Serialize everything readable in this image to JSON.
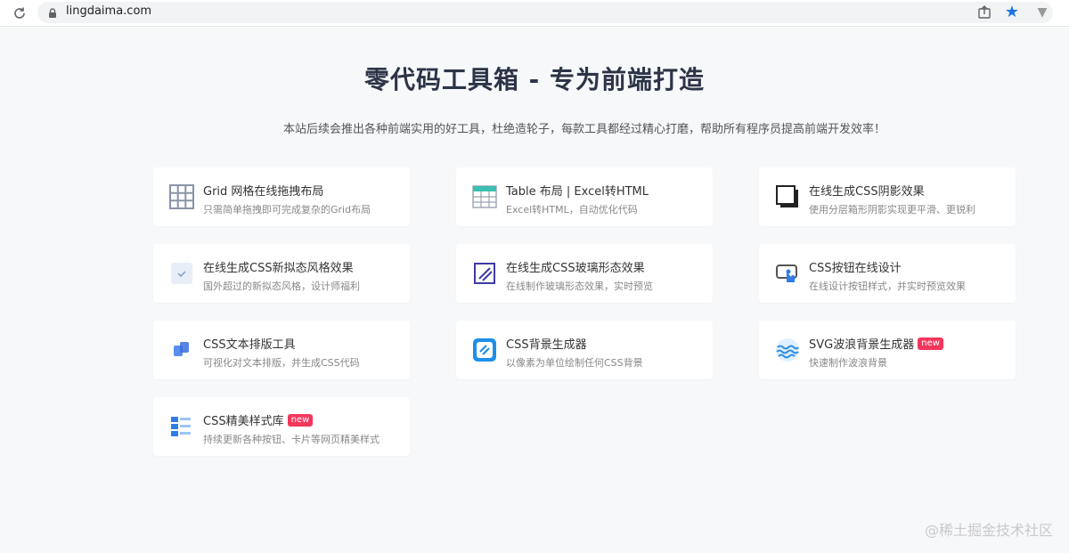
{
  "browser": {
    "url": "lingdaima.com"
  },
  "page": {
    "title": "零代码工具箱 - 专为前端打造",
    "subtitle": "本站后续会推出各种前端实用的好工具，杜绝造轮子，每款工具都经过精心打磨，帮助所有程序员提高前端开发效率！"
  },
  "tools": [
    {
      "title": "Grid 网格在线拖拽布局",
      "desc": "只需简单拖拽即可完成复杂的Grid布局",
      "badge": "",
      "icon": "grid-icon"
    },
    {
      "title": "Table 布局 | Excel转HTML",
      "desc": "Excel转HTML，自动优化代码",
      "badge": "",
      "icon": "table-icon"
    },
    {
      "title": "在线生成CSS阴影效果",
      "desc": "使用分层箱形阴影实现更平滑、更锐利",
      "badge": "",
      "icon": "shadow-icon"
    },
    {
      "title": "在线生成CSS新拟态风格效果",
      "desc": "国外超过的新拟态风格，设计师福利",
      "badge": "",
      "icon": "neumorphism-icon"
    },
    {
      "title": "在线生成CSS玻璃形态效果",
      "desc": "在线制作玻璃形态效果，实时预览",
      "badge": "",
      "icon": "glass-icon"
    },
    {
      "title": "CSS按钮在线设计",
      "desc": "在线设计按钮样式，并实时预览效果",
      "badge": "",
      "icon": "button-icon"
    },
    {
      "title": "CSS文本排版工具",
      "desc": "可视化对文本排版，并生成CSS代码",
      "badge": "",
      "icon": "text-layout-icon"
    },
    {
      "title": "CSS背景生成器",
      "desc": "以像素为单位绘制任何CSS背景",
      "badge": "",
      "icon": "background-icon"
    },
    {
      "title": "SVG波浪背景生成器",
      "desc": "快速制作波浪背景",
      "badge": "new",
      "icon": "wave-icon"
    },
    {
      "title": "CSS精美样式库",
      "desc": "持续更新各种按钮、卡片等网页精美样式",
      "badge": "new",
      "icon": "style-library-icon"
    }
  ],
  "watermark": "@稀土掘金技术社区"
}
